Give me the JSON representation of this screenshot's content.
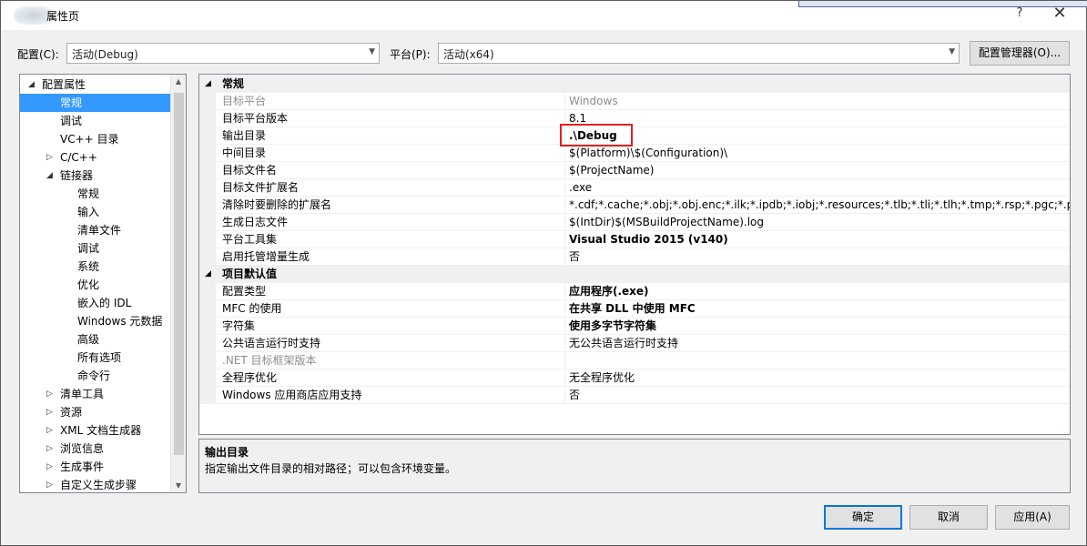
{
  "window": {
    "title": "属性页",
    "help_glyph": "?",
    "close_glyph": "✕"
  },
  "config_bar": {
    "config_label": "配置(C):",
    "config_value": "活动(Debug)",
    "platform_label": "平台(P):",
    "platform_value": "活动(x64)",
    "manager_button": "配置管理器(O)..."
  },
  "tree": {
    "items": [
      {
        "label": "配置属性",
        "level": 0,
        "expander": "◢"
      },
      {
        "label": "常规",
        "level": 1,
        "selected": true
      },
      {
        "label": "调试",
        "level": 1
      },
      {
        "label": "VC++ 目录",
        "level": 1
      },
      {
        "label": "C/C++",
        "level": 1,
        "expander": "▷"
      },
      {
        "label": "链接器",
        "level": 1,
        "expander": "◢"
      },
      {
        "label": "常规",
        "level": 2
      },
      {
        "label": "输入",
        "level": 2
      },
      {
        "label": "清单文件",
        "level": 2
      },
      {
        "label": "调试",
        "level": 2
      },
      {
        "label": "系统",
        "level": 2
      },
      {
        "label": "优化",
        "level": 2
      },
      {
        "label": "嵌入的 IDL",
        "level": 2
      },
      {
        "label": "Windows 元数据",
        "level": 2
      },
      {
        "label": "高级",
        "level": 2
      },
      {
        "label": "所有选项",
        "level": 2
      },
      {
        "label": "命令行",
        "level": 2
      },
      {
        "label": "清单工具",
        "level": 1,
        "expander": "▷"
      },
      {
        "label": "资源",
        "level": 1,
        "expander": "▷"
      },
      {
        "label": "XML 文档生成器",
        "level": 1,
        "expander": "▷"
      },
      {
        "label": "浏览信息",
        "level": 1,
        "expander": "▷"
      },
      {
        "label": "生成事件",
        "level": 1,
        "expander": "▷"
      },
      {
        "label": "自定义生成步骤",
        "level": 1,
        "expander": "▷"
      }
    ]
  },
  "grid": {
    "sections": [
      {
        "title": "常规",
        "rows": [
          {
            "name": "目标平台",
            "value": "Windows",
            "dim": true
          },
          {
            "name": "目标平台版本",
            "value": "8.1"
          },
          {
            "name": "输出目录",
            "value": ".\\Debug",
            "bold": true
          },
          {
            "name": "中间目录",
            "value": "$(Platform)\\$(Configuration)\\"
          },
          {
            "name": "目标文件名",
            "value": "$(ProjectName)"
          },
          {
            "name": "目标文件扩展名",
            "value": ".exe"
          },
          {
            "name": "清除时要删除的扩展名",
            "value": "*.cdf;*.cache;*.obj;*.obj.enc;*.ilk;*.ipdb;*.iobj;*.resources;*.tlb;*.tli;*.tlh;*.tmp;*.rsp;*.pgc;*.pgd;*.meta"
          },
          {
            "name": "生成日志文件",
            "value": "$(IntDir)$(MSBuildProjectName).log"
          },
          {
            "name": "平台工具集",
            "value": "Visual Studio 2015 (v140)",
            "bold": true
          },
          {
            "name": "启用托管增量生成",
            "value": "否"
          }
        ]
      },
      {
        "title": "项目默认值",
        "rows": [
          {
            "name": "配置类型",
            "value": "应用程序(.exe)",
            "bold": true
          },
          {
            "name": "MFC 的使用",
            "value": "在共享 DLL 中使用 MFC",
            "bold": true
          },
          {
            "name": "字符集",
            "value": "使用多字节字符集",
            "bold": true
          },
          {
            "name": "公共语言运行时支持",
            "value": "无公共语言运行时支持"
          },
          {
            "name": ".NET 目标框架版本",
            "value": "",
            "dim": true
          },
          {
            "name": "全程序优化",
            "value": "无全程序优化"
          },
          {
            "name": "Windows 应用商店应用支持",
            "value": "否"
          }
        ]
      }
    ]
  },
  "description": {
    "title": "输出目录",
    "text": "指定输出文件目录的相对路径；可以包含环境变量。"
  },
  "buttons": {
    "ok": "确定",
    "cancel": "取消",
    "apply": "应用(A)"
  }
}
